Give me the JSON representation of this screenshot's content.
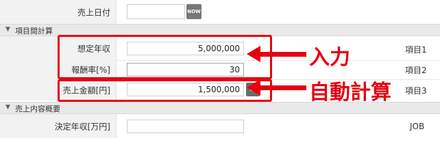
{
  "sales_date": {
    "label": "売上日付",
    "now_button": "NOW"
  },
  "section_calc": {
    "title": "項目間計算"
  },
  "calc_rows": [
    {
      "label": "想定年収",
      "value": "5,000,000",
      "tag": "項目1"
    },
    {
      "label": "報酬率[%]",
      "value": "30",
      "tag": "項目2"
    },
    {
      "label": "売上金額[円]",
      "value": "1,500,000",
      "tag": "項目3"
    }
  ],
  "annotations": {
    "input": "入力",
    "auto": "自動計算"
  },
  "section_overview": {
    "title": "売上内容概要"
  },
  "decided_income": {
    "label": "決定年収[万円]",
    "value": "",
    "tag": "JOB"
  },
  "colors": {
    "highlight": "#e60012",
    "section_bg": "#e9e9e9",
    "label_bg": "#f2f2f2"
  },
  "icons": {
    "calc_button": "calculator-icon"
  }
}
